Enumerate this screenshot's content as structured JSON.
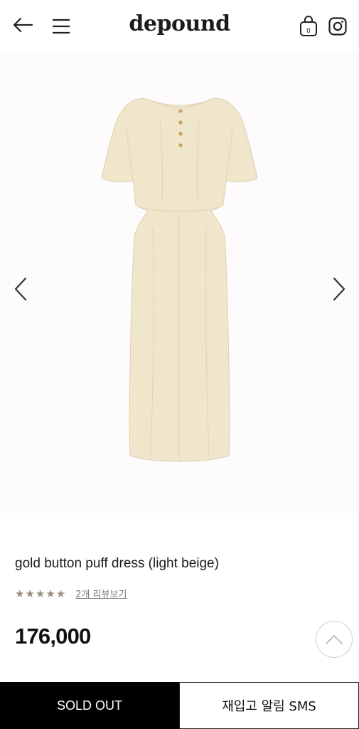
{
  "header": {
    "logo": "depound",
    "cart_count": "0",
    "icons": {
      "back": "arrow-left-icon",
      "menu": "hamburger-menu-icon",
      "cart": "shopping-bag-icon",
      "instagram": "instagram-icon"
    }
  },
  "gallery": {
    "icons": {
      "prev": "chevron-left-icon",
      "next": "chevron-right-icon"
    },
    "colors": {
      "background": "#fdfbfc",
      "dress": "#efe6cc"
    }
  },
  "product": {
    "name": "gold button puff dress (light beige)",
    "rating": 5,
    "review_link": "2개 리뷰보기",
    "price": "176,000"
  },
  "actions": {
    "sold_out": "SOLD OUT",
    "restock_sms": "재입고 알림 SMS",
    "scroll_top_icon": "chevron-up-icon"
  }
}
